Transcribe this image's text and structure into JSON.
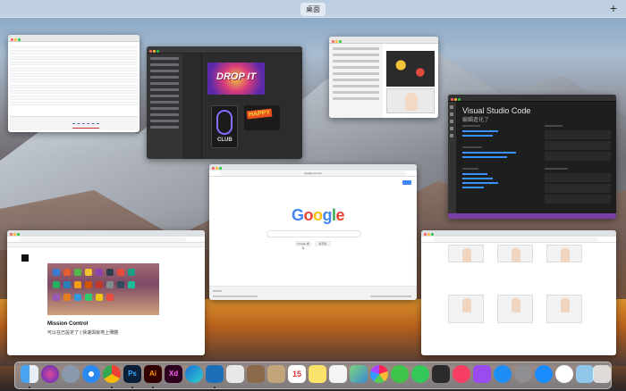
{
  "top_bar": {
    "desktop_label": "桌面",
    "add_label": "+"
  },
  "windows": {
    "google": {
      "logo": "Google",
      "url": "google.com.tw",
      "btn_search": "Google 搜尋",
      "btn_lucky": "好手氣"
    },
    "vscode": {
      "title": "Visual Studio Code",
      "subtitle": "編輯進化了"
    },
    "medium": {
      "heading": "Mission Control",
      "body": "可以在已設定了 | 快速與就地上傳體"
    }
  },
  "dock": {
    "calendar_day": "15",
    "apps": [
      {
        "name": "finder",
        "label": ""
      },
      {
        "name": "siri",
        "label": ""
      },
      {
        "name": "launchpad",
        "label": ""
      },
      {
        "name": "safari",
        "label": ""
      },
      {
        "name": "chrome",
        "label": ""
      },
      {
        "name": "photoshop",
        "label": "Ps"
      },
      {
        "name": "illustrator",
        "label": "Ai"
      },
      {
        "name": "xd",
        "label": "Xd"
      },
      {
        "name": "edge",
        "label": ""
      },
      {
        "name": "vscode",
        "label": ""
      }
    ]
  },
  "colors": {
    "accent": "#4285f4",
    "vscode_status": "#7a3ea8"
  }
}
